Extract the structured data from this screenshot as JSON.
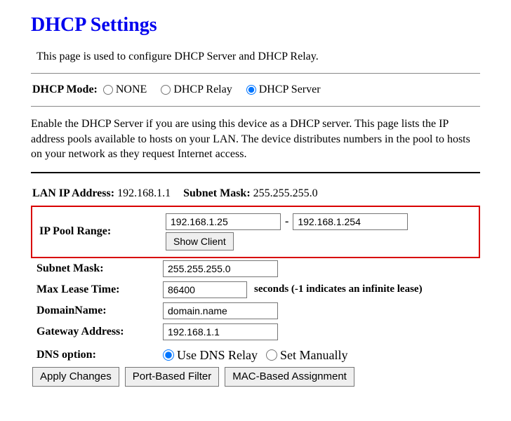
{
  "page": {
    "title": "DHCP Settings",
    "intro": "This page is used to configure DHCP Server and DHCP Relay.",
    "description": "Enable the DHCP Server if you are using this device as a DHCP server. This page lists the IP address pools available to hosts on your LAN. The device distributes numbers in the pool to hosts on your network as they request Internet access."
  },
  "mode": {
    "label": "DHCP Mode:",
    "options": {
      "none": "NONE",
      "relay": "DHCP Relay",
      "server": "DHCP Server"
    }
  },
  "lan": {
    "ip_label": "LAN IP Address:",
    "ip_value": "192.168.1.1",
    "mask_label": "Subnet Mask:",
    "mask_value": "255.255.255.0"
  },
  "fields": {
    "pool_label": "IP Pool Range:",
    "pool_start": "192.168.1.25",
    "pool_end": "192.168.1.254",
    "show_client": "Show Client",
    "subnet_label": "Subnet Mask:",
    "subnet_value": "255.255.255.0",
    "lease_label": "Max Lease Time:",
    "lease_value": "86400",
    "lease_hint": "seconds (-1 indicates an infinite lease)",
    "domain_label": "DomainName:",
    "domain_value": "domain.name",
    "gateway_label": "Gateway Address:",
    "gateway_value": "192.168.1.1",
    "dns_label": "DNS option:",
    "dns_relay": "Use DNS Relay",
    "dns_manual": "Set Manually"
  },
  "buttons": {
    "apply": "Apply Changes",
    "port_filter": "Port-Based Filter",
    "mac_assign": "MAC-Based Assignment"
  }
}
